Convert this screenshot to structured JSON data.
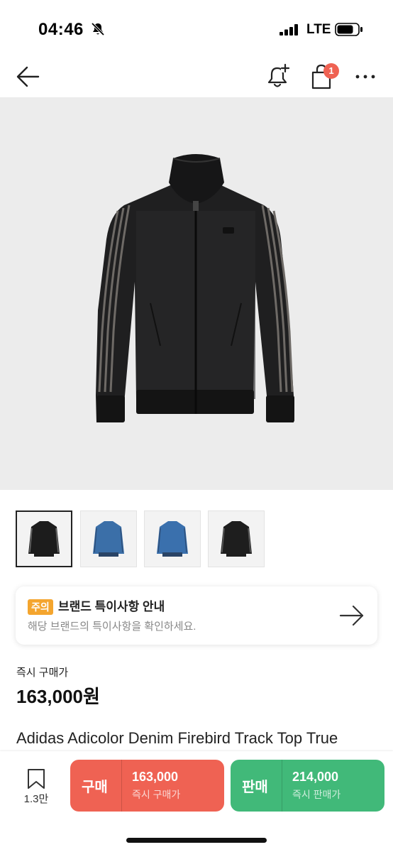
{
  "status_bar": {
    "time": "04:46",
    "network": "LTE"
  },
  "nav": {
    "cart_badge": "1"
  },
  "hero": {
    "image_alt": "black denim track jacket"
  },
  "thumbnails": [
    {
      "color": "#1c1c1c",
      "stripe": "#6a6a6a"
    },
    {
      "color": "#3b6fa8",
      "stripe": "#2d4f7a"
    },
    {
      "color": "#3a70ad",
      "stripe": "#2d4f7a"
    },
    {
      "color": "#1e1e1e",
      "stripe": "#5b5b5b"
    }
  ],
  "notice": {
    "tag": "주의",
    "title": "브랜드 특이사항 안내",
    "description": "해당 브랜드의 특이사항을 확인하세요."
  },
  "price": {
    "label": "즉시 구매가",
    "value": "163,000원"
  },
  "product": {
    "title": "Adidas Adicolor Denim Firebird Track Top True"
  },
  "bottom_bar": {
    "wish_count": "1.3만",
    "buy": {
      "label": "구매",
      "price": "163,000",
      "sub": "즉시 구매가",
      "color": "#ef6253"
    },
    "sell": {
      "label": "판매",
      "price": "214,000",
      "sub": "즉시 판매가",
      "color": "#41b979"
    }
  }
}
